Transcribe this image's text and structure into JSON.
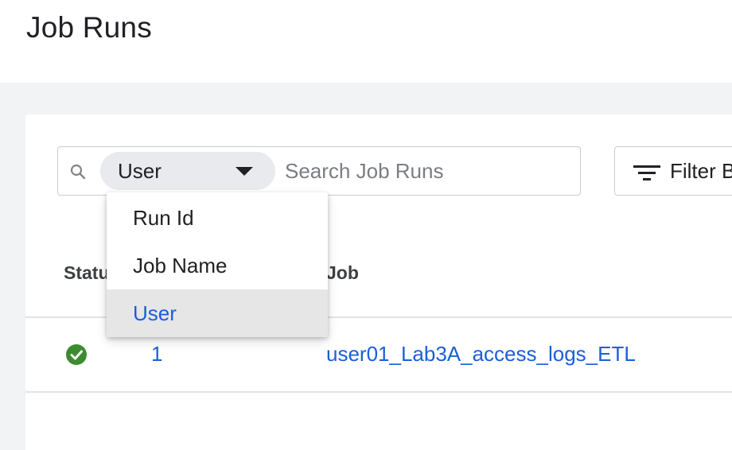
{
  "page": {
    "title": "Job Runs"
  },
  "search": {
    "field_selected": "User",
    "placeholder": "Search Job Runs",
    "value": ""
  },
  "filter": {
    "label": "Filter B"
  },
  "field_menu": {
    "options": [
      "Run Id",
      "Job Name",
      "User"
    ],
    "selected": "User"
  },
  "table": {
    "headers": {
      "status": "Statu",
      "job": "Job"
    },
    "rows": [
      {
        "status": "success",
        "run_id": "1",
        "job": "user01_Lab3A_access_logs_ETL"
      }
    ]
  },
  "colors": {
    "link": "#1a5fd8",
    "success": "#3d8b2f",
    "page_background": "#f2f3f4"
  }
}
